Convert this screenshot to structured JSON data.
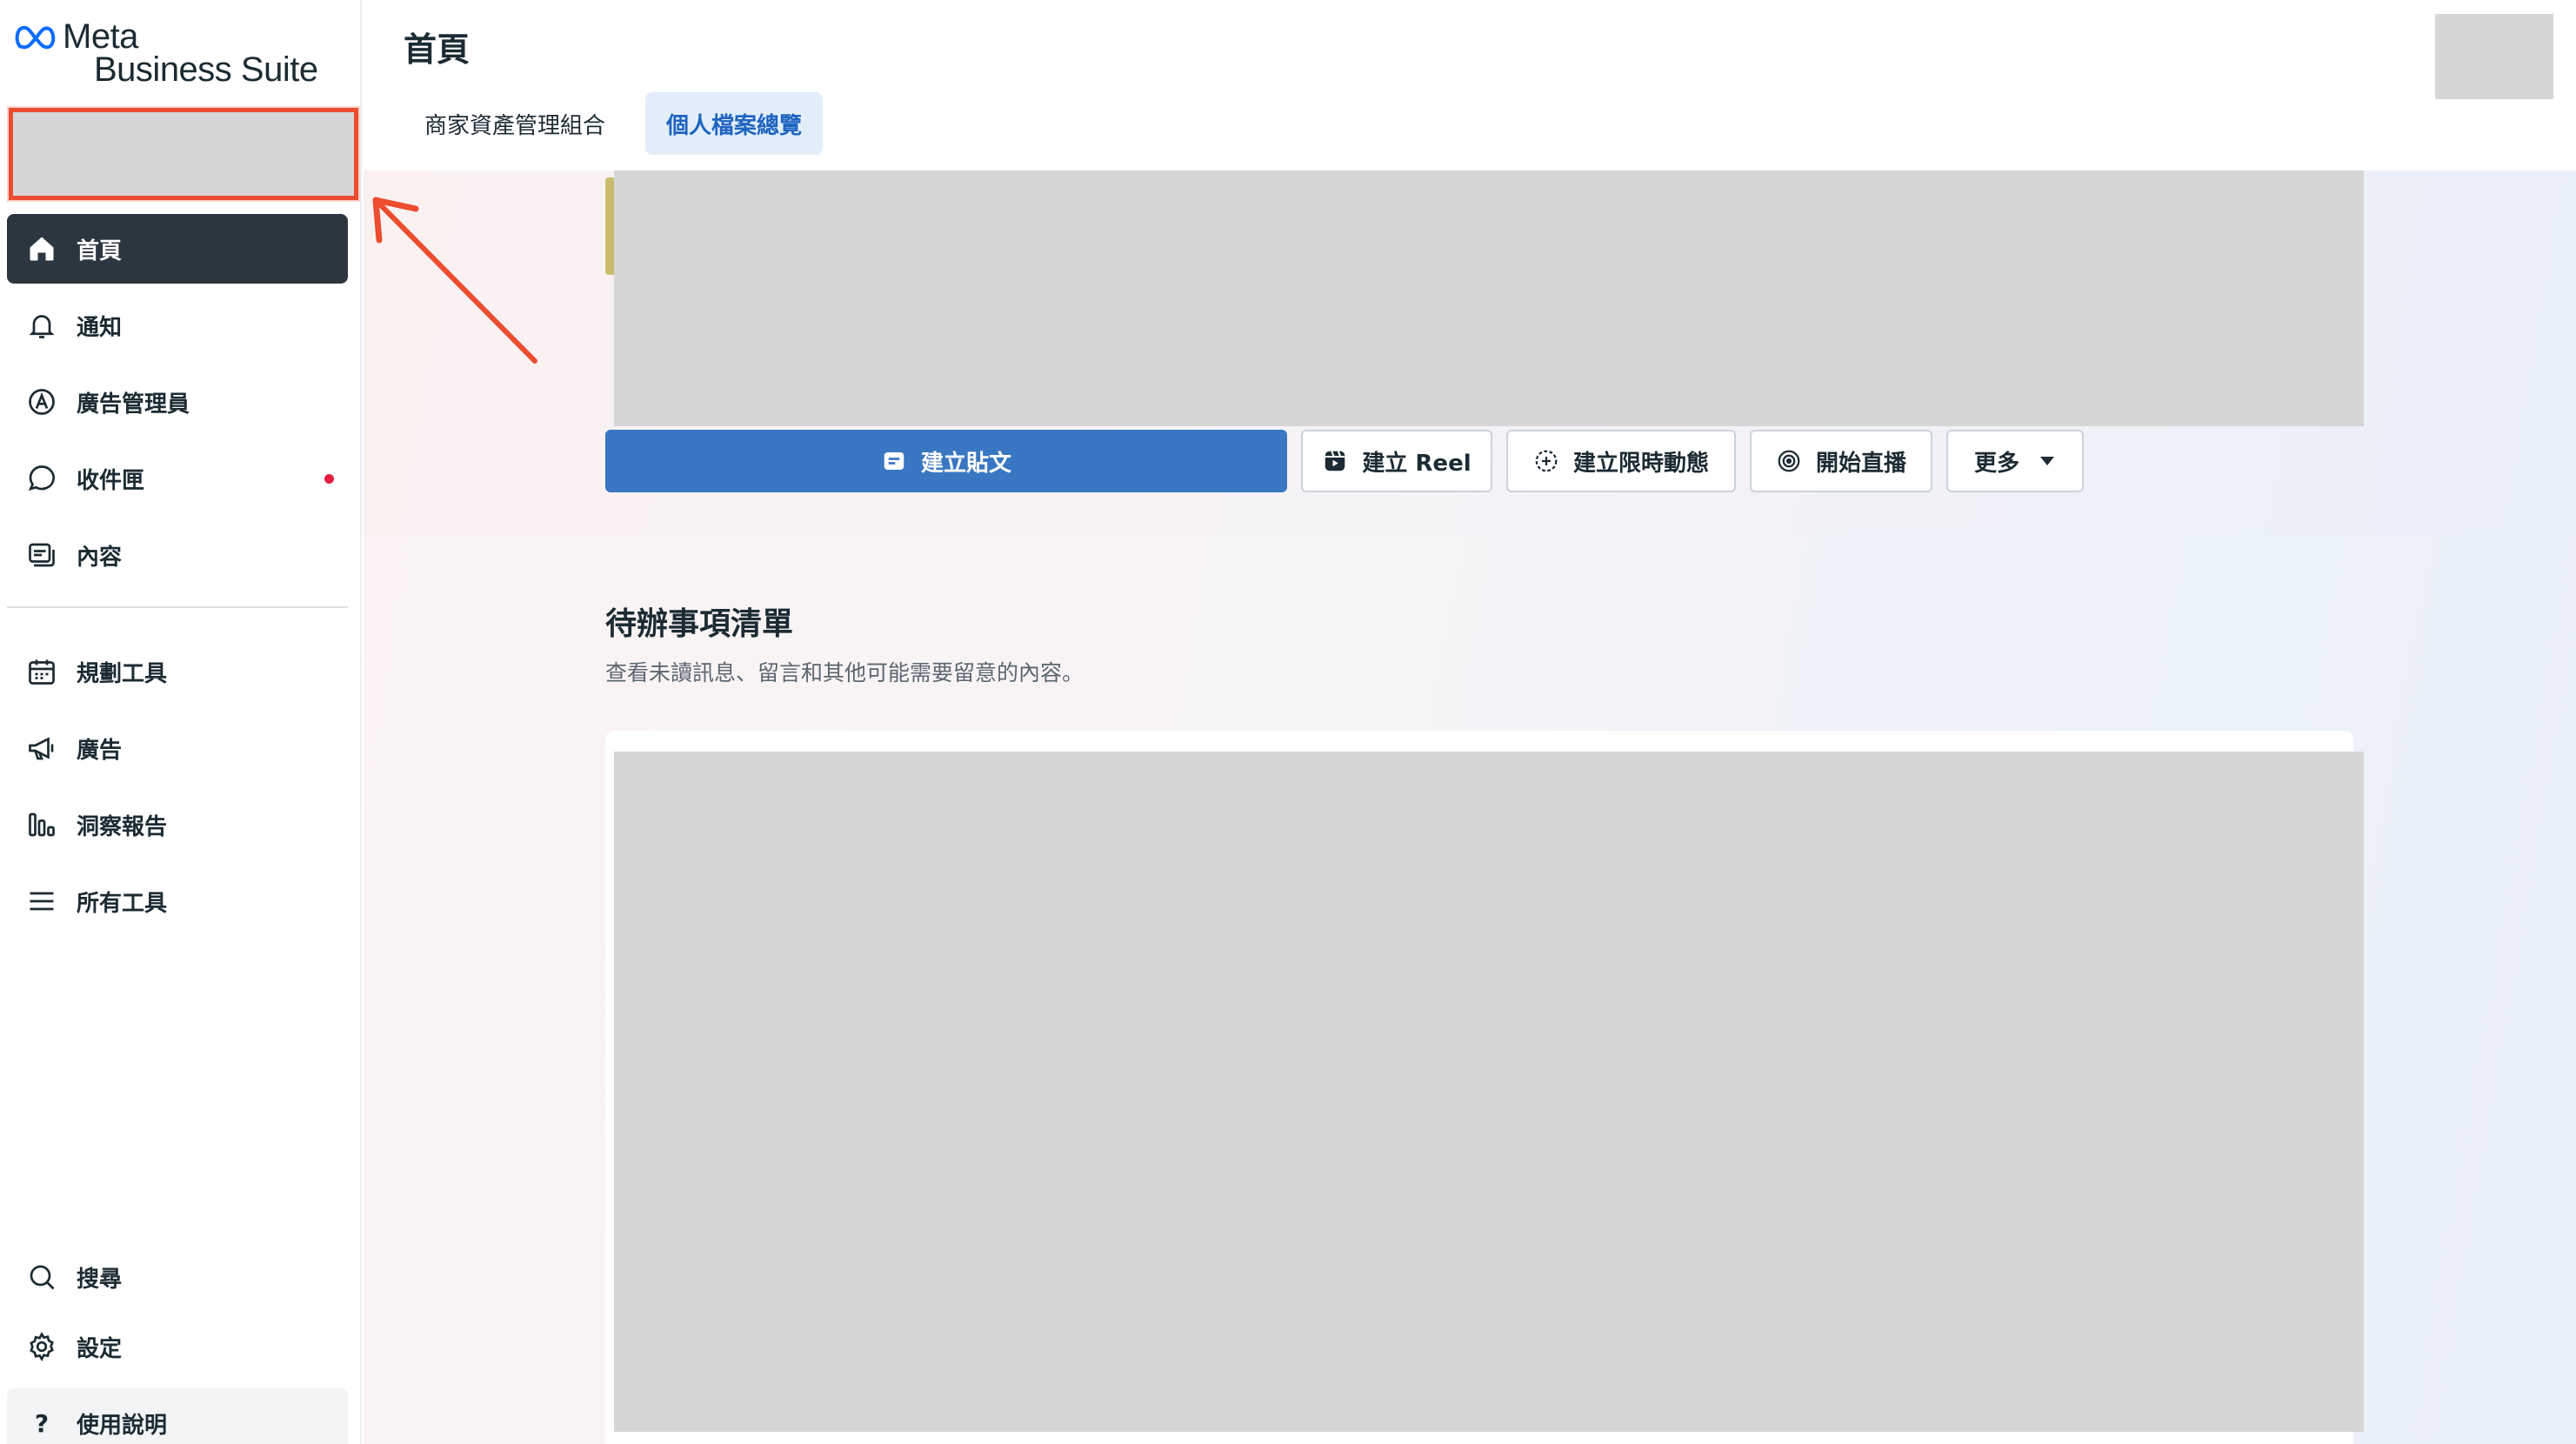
{
  "brand": {
    "line1": "Meta",
    "line2": "Business Suite"
  },
  "sidebar": {
    "items": [
      {
        "label": "首頁",
        "icon": "home-icon",
        "active": true
      },
      {
        "label": "通知",
        "icon": "bell-icon"
      },
      {
        "label": "廣告管理員",
        "icon": "ads-manager-icon"
      },
      {
        "label": "收件匣",
        "icon": "chat-bubble-icon",
        "has_unread_dot": true
      },
      {
        "label": "內容",
        "icon": "content-icon"
      },
      {
        "label": "規劃工具",
        "icon": "calendar-icon"
      },
      {
        "label": "廣告",
        "icon": "megaphone-icon"
      },
      {
        "label": "洞察報告",
        "icon": "bar-chart-icon"
      },
      {
        "label": "所有工具",
        "icon": "menu-icon"
      }
    ],
    "bottom": [
      {
        "label": "搜尋",
        "icon": "search-icon"
      },
      {
        "label": "設定",
        "icon": "gear-icon"
      },
      {
        "label": "使用說明",
        "icon": "help-icon",
        "glyph": "?"
      }
    ]
  },
  "header": {
    "title": "首頁",
    "tabs": [
      {
        "label": "商家資產管理組合",
        "active": false
      },
      {
        "label": "個人檔案總覽",
        "active": true
      }
    ]
  },
  "actions": {
    "create_post": "建立貼文",
    "create_reel": "建立 Reel",
    "create_story": "建立限時動態",
    "go_live": "開始直播",
    "more": "更多"
  },
  "todo": {
    "title": "待辦事項清單",
    "subtitle": "查看未讀訊息、留言和其他可能需要留意的內容。"
  },
  "colors": {
    "active_nav": "#2b3640",
    "primary_button": "#3a77c2",
    "active_tab_bg": "#e2eefa",
    "active_tab_text": "#1f64c0",
    "annotation_red": "#ec4d2f",
    "unread_dot": "#e41e3f",
    "redacted": "#d6d6d6"
  }
}
